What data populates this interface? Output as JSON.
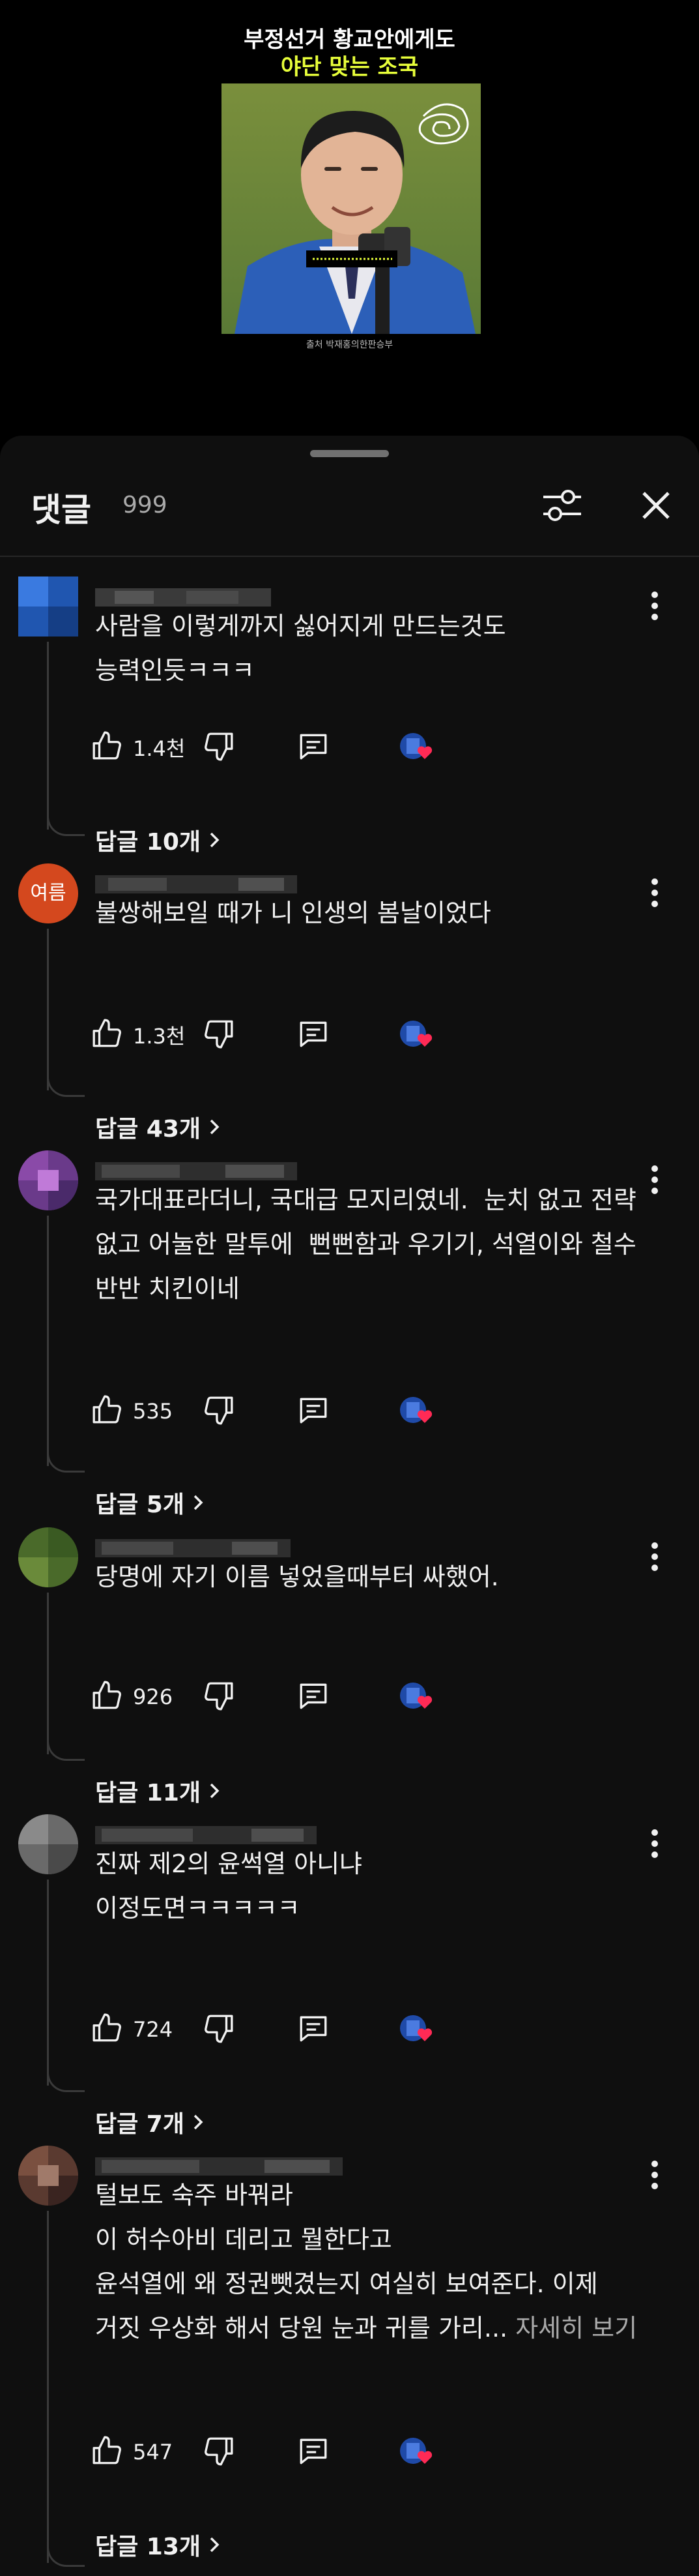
{
  "video": {
    "title_line1": "부정선거 황교안에게도",
    "title_line2": "야단 맞는 조국",
    "caption": "출처 박재홍의한판승부"
  },
  "comments_panel": {
    "title": "댓글",
    "count": "999",
    "icons": {
      "filter": "sliders-icon",
      "close": "close-icon"
    }
  },
  "comments": [
    {
      "avatar_text": "",
      "lines": [
        "사람을 이렇게까지 싫어지게 만드는것도",
        "능력인듯ㅋㅋㅋ"
      ],
      "likes": "1.4천",
      "replies": "답글 10개"
    },
    {
      "avatar_text": "여름",
      "lines": [
        "불쌍해보일 때가 니 인생의 봄날이었다"
      ],
      "likes": "1.3천",
      "replies": "답글 43개"
    },
    {
      "avatar_text": "",
      "lines": [
        "국가대표라더니, 국대급 모지리였네.  눈치 없고 전략",
        "없고 어눌한 말투에  뻔뻔함과 우기기, 석열이와 철수",
        "반반 치킨이네"
      ],
      "likes": "535",
      "replies": "답글 5개"
    },
    {
      "avatar_text": "",
      "lines": [
        "당명에 자기 이름 넣었을때부터 싸했어."
      ],
      "likes": "926",
      "replies": "답글 11개"
    },
    {
      "avatar_text": "",
      "lines": [
        "진짜 제2의 윤썩열 아니냐",
        "이정도면ㅋㅋㅋㅋㅋ"
      ],
      "likes": "724",
      "replies": "답글 7개"
    },
    {
      "avatar_text": "",
      "lines": [
        "털보도 숙주 바꿔라",
        "이 허수아비 데리고 뭘한다고",
        "윤석열에 왜 정권뺏겼는지 여실히 보여준다. 이제",
        "거짓 우상화 해서 당원 눈과 귀를 가리... "
      ],
      "more_label": "자세히 보기",
      "likes": "547",
      "replies": "답글 13개"
    }
  ],
  "colors": {
    "background": "#0f0f0f",
    "text": "#f1f1f1",
    "secondary": "#aaaaaa",
    "heart": "#ff2a55",
    "title_accent": "#e8ff3a"
  }
}
